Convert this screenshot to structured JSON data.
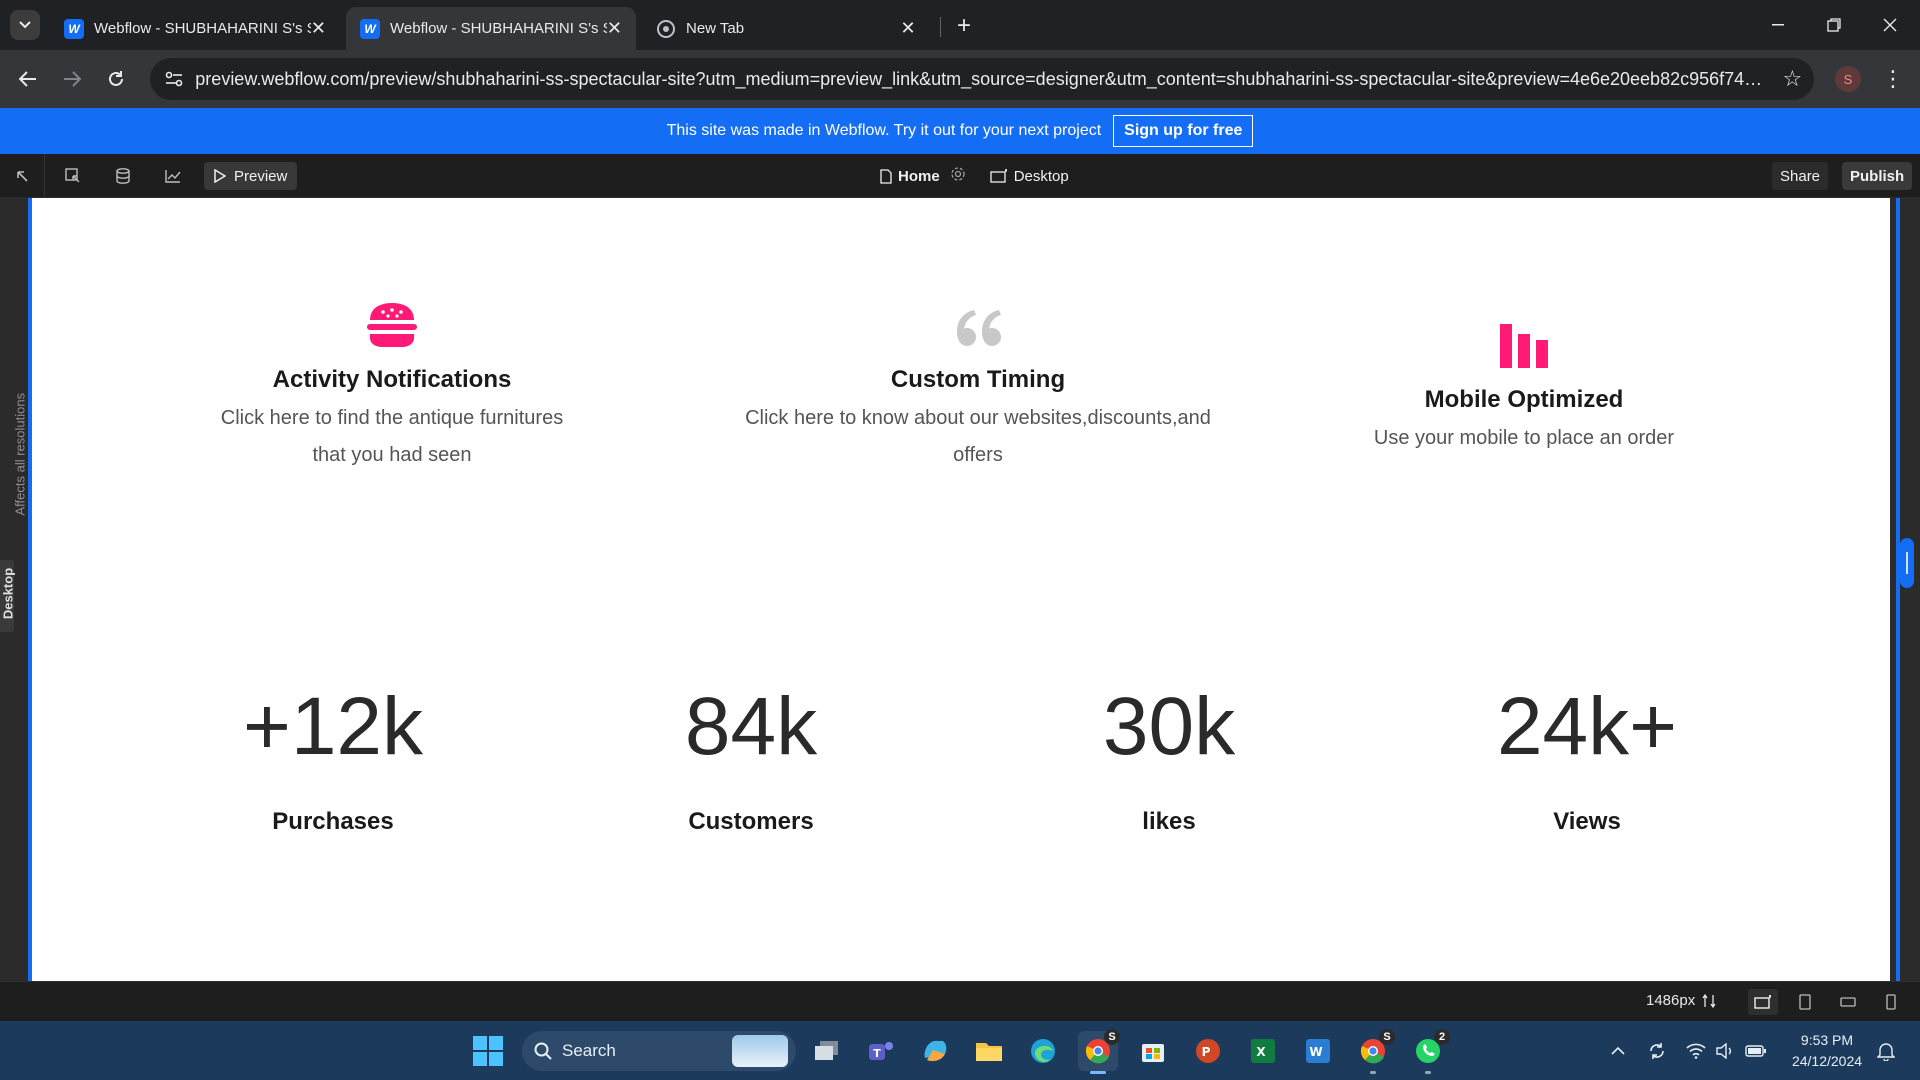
{
  "browser": {
    "tabs": [
      {
        "title": "Webflow - SHUBHAHARINI S's Spectacular Site",
        "active": false
      },
      {
        "title": "Webflow - SHUBHAHARINI S's Spectacular Site",
        "active": true
      },
      {
        "title": "New Tab",
        "active": false
      }
    ],
    "url": "preview.webflow.com/preview/shubhaharini-ss-spectacular-site?utm_medium=preview_link&utm_source=designer&utm_content=shubhaharini-ss-spectacular-site&preview=4e6e20eeb82c956f74bee6...",
    "profile_initial": "S"
  },
  "promo": {
    "text": "This site was made in Webflow.  Try it out for your next project",
    "signup_label": "Sign up for free"
  },
  "designer": {
    "preview_label": "Preview",
    "page_label": "Home",
    "device_label": "Desktop",
    "share_label": "Share",
    "publish_label": "Publish",
    "side_affects_label": "Affects all resolutions",
    "side_device_label": "Desktop"
  },
  "features": [
    {
      "icon": "burger-icon",
      "title": "Activity Notifications",
      "desc_line1": "Click here to find the antique furnitures",
      "desc_line2": "that you had seen"
    },
    {
      "icon": "quote-icon",
      "title": "Custom Timing",
      "desc_line1": "Click here to know about our websites,discounts,and",
      "desc_line2": "offers"
    },
    {
      "icon": "bar-chart-icon",
      "title": "Mobile Optimized",
      "desc_line1": "Use your mobile to place an order",
      "desc_line2": ""
    }
  ],
  "stats": [
    {
      "value": "+12k",
      "label": "Purchases"
    },
    {
      "value": "84k",
      "label": "Customers"
    },
    {
      "value": "30k",
      "label": "likes"
    },
    {
      "value": "24k+",
      "label": "Views"
    }
  ],
  "statusbar": {
    "width_label": "1486px"
  },
  "taskbar": {
    "search_label": "Search",
    "time": "9:53 PM",
    "date": "24/12/2024",
    "chrome_profile_badge": "S",
    "whatsapp_badge": "2"
  },
  "colors": {
    "accent_pink": "#ff1a75",
    "webflow_blue": "#146ef5",
    "quote_grey": "#c8c8c8"
  }
}
